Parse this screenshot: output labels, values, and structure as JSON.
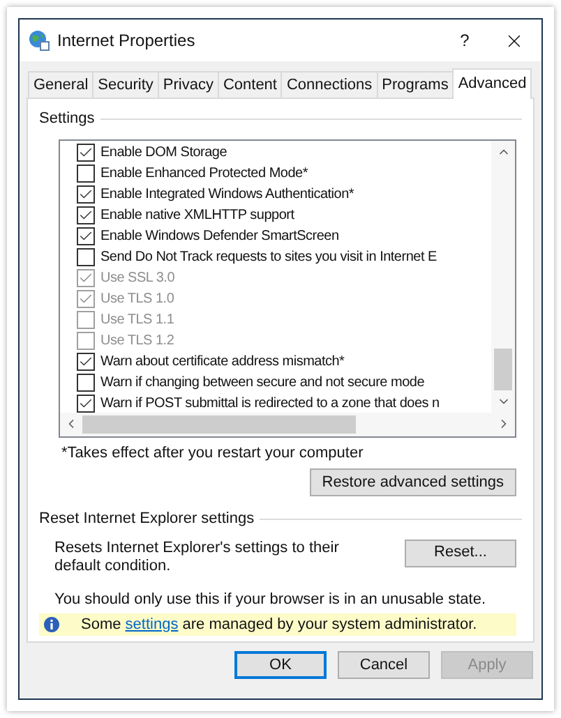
{
  "window": {
    "title": "Internet Properties",
    "help_label": "?"
  },
  "tabs": [
    {
      "label": "General",
      "selected": false
    },
    {
      "label": "Security",
      "selected": false
    },
    {
      "label": "Privacy",
      "selected": false
    },
    {
      "label": "Content",
      "selected": false
    },
    {
      "label": "Connections",
      "selected": false
    },
    {
      "label": "Programs",
      "selected": false
    },
    {
      "label": "Advanced",
      "selected": true
    }
  ],
  "settings": {
    "title": "Settings",
    "items": [
      {
        "label": "Enable DOM Storage",
        "checked": true,
        "disabled": false
      },
      {
        "label": "Enable Enhanced Protected Mode*",
        "checked": false,
        "disabled": false
      },
      {
        "label": "Enable Integrated Windows Authentication*",
        "checked": true,
        "disabled": false
      },
      {
        "label": "Enable native XMLHTTP support",
        "checked": true,
        "disabled": false
      },
      {
        "label": "Enable Windows Defender SmartScreen",
        "checked": true,
        "disabled": false
      },
      {
        "label": "Send Do Not Track requests to sites you visit in Internet E",
        "checked": false,
        "disabled": false
      },
      {
        "label": "Use SSL 3.0",
        "checked": true,
        "disabled": true
      },
      {
        "label": "Use TLS 1.0",
        "checked": true,
        "disabled": true
      },
      {
        "label": "Use TLS 1.1",
        "checked": false,
        "disabled": true
      },
      {
        "label": "Use TLS 1.2",
        "checked": false,
        "disabled": true
      },
      {
        "label": "Warn about certificate address mismatch*",
        "checked": true,
        "disabled": false
      },
      {
        "label": "Warn if changing between secure and not secure mode",
        "checked": false,
        "disabled": false
      },
      {
        "label": "Warn if POST submittal is redirected to a zone that does n",
        "checked": true,
        "disabled": false
      }
    ],
    "footnote": "*Takes effect after you restart your computer",
    "restore_button": "Restore advanced settings"
  },
  "reset": {
    "title": "Reset Internet Explorer settings",
    "description": "Resets Internet Explorer's settings to their default condition.",
    "button": "Reset...",
    "warning": "You should only use this if your browser is in an unusable state."
  },
  "info_bar": {
    "before": "Some ",
    "link": "settings",
    "after": " are managed by your system administrator."
  },
  "buttons": [
    {
      "label": "OK",
      "default": true,
      "disabled": false
    },
    {
      "label": "Cancel",
      "default": false,
      "disabled": false
    },
    {
      "label": "Apply",
      "default": false,
      "disabled": true
    }
  ]
}
